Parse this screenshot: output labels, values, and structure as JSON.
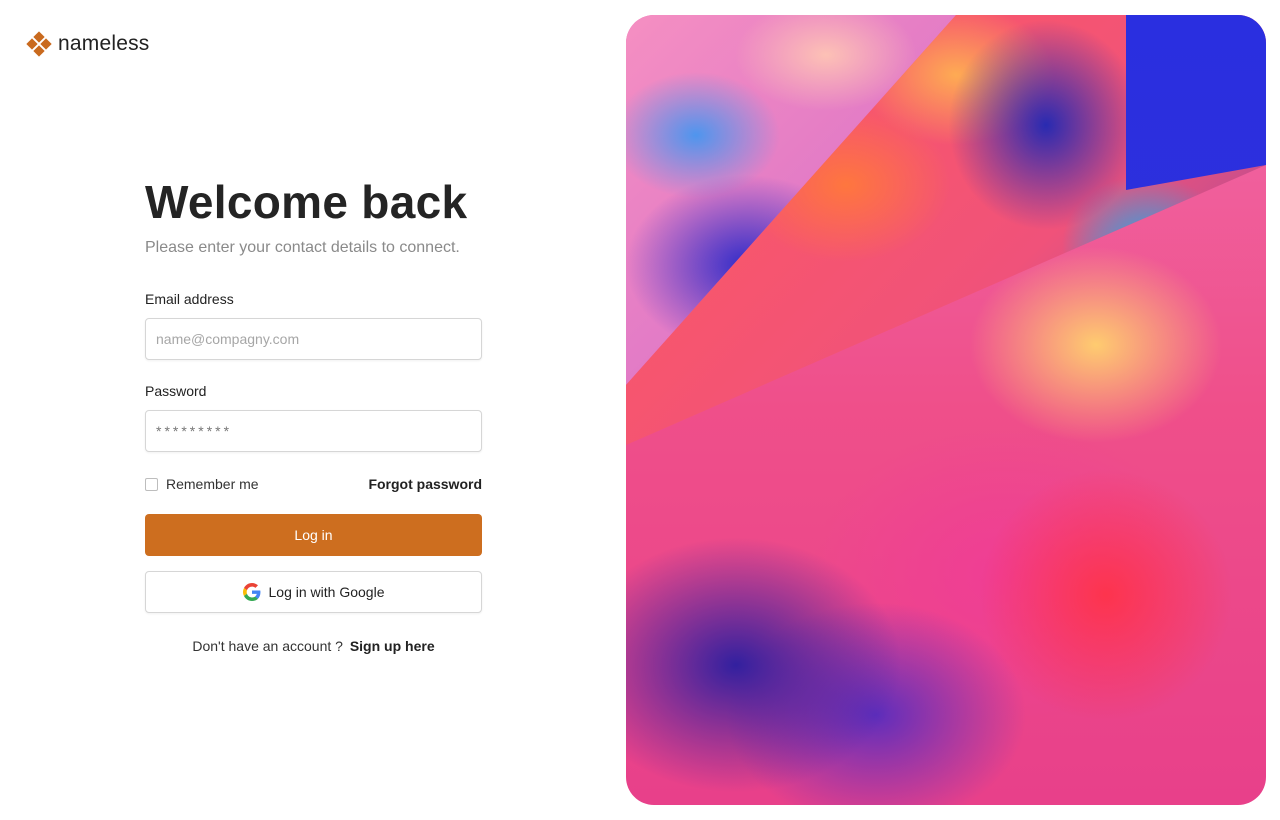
{
  "brand": {
    "name": "nameless",
    "accent": "#cd6e1f"
  },
  "form": {
    "title": "Welcome back",
    "subtitle": "Please enter your contact details to connect.",
    "email": {
      "label": "Email address",
      "placeholder": "name@compagny.com",
      "value": ""
    },
    "password": {
      "label": "Password",
      "placeholder": "*********",
      "value": ""
    },
    "remember_label": "Remember me",
    "remember_checked": false,
    "forgot_label": "Forgot password",
    "login_label": "Log in",
    "google_label": "Log in with Google",
    "signup_prompt": "Don't have an account ?",
    "signup_link": "Sign up here"
  },
  "icons": {
    "logo": "logo-diamond-icon",
    "google": "google-g-icon"
  }
}
